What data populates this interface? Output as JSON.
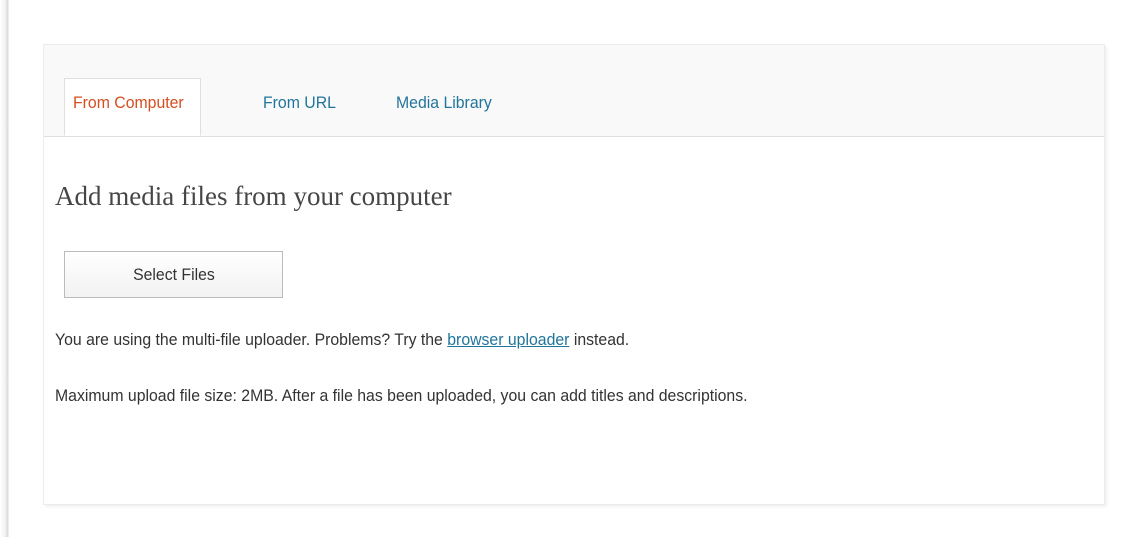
{
  "tabs": [
    {
      "label": "From Computer",
      "active": true
    },
    {
      "label": "From URL",
      "active": false
    },
    {
      "label": "Media Library",
      "active": false
    }
  ],
  "heading": "Add media files from your computer",
  "select_files_button": "Select Files",
  "uploader_notice": {
    "prefix": "You are using the multi-file uploader. Problems? Try the ",
    "link": "browser uploader",
    "suffix": " instead."
  },
  "max_size_text": "Maximum upload file size: 2MB. After a file has been uploaded, you can add titles and descriptions.",
  "colors": {
    "active_tab": "#d54e21",
    "link": "#21759b",
    "text": "#333333"
  }
}
